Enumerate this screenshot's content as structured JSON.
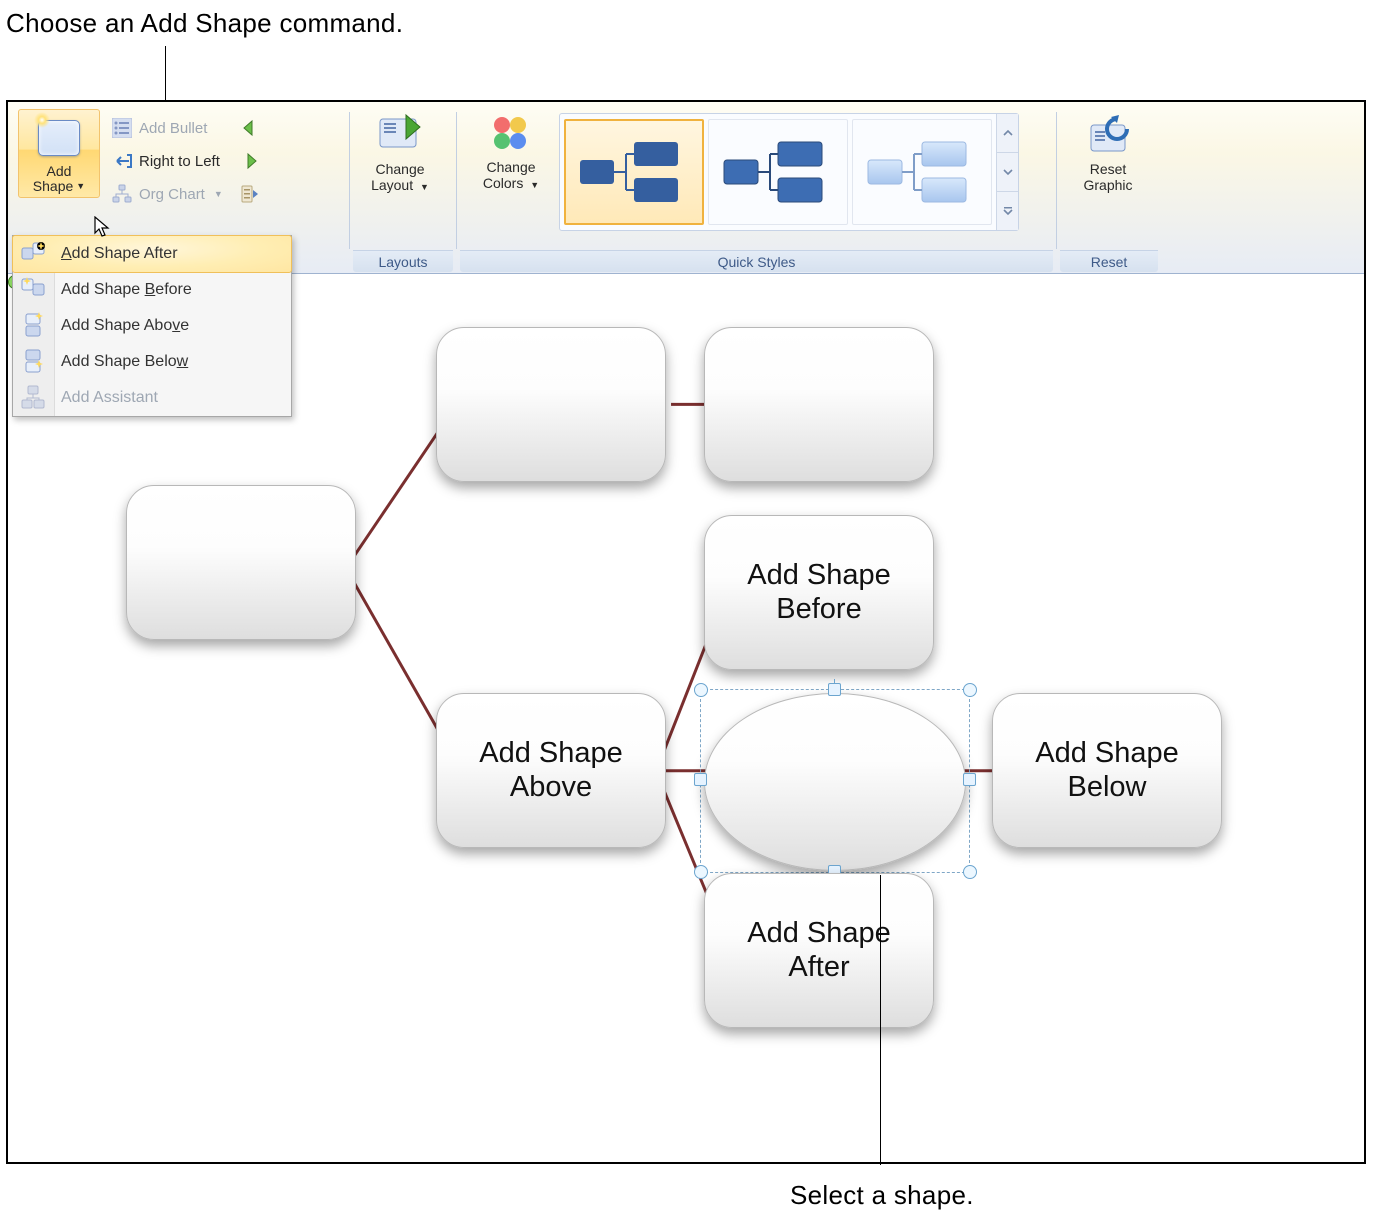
{
  "annotations": {
    "top": "Choose an Add Shape command.",
    "bottom": "Select a shape."
  },
  "ribbon": {
    "groups": {
      "create_graphic": {
        "add_shape": {
          "line1": "Add",
          "line2": "Shape"
        },
        "add_bullet": "Add Bullet",
        "rtl": "Right to Left",
        "org_chart": "Org Chart"
      },
      "layouts": {
        "label": "Layouts",
        "change_layout": "Change Layout"
      },
      "quick_styles": {
        "label": "Quick Styles",
        "change_colors": "Change Colors"
      },
      "reset": {
        "label": "Reset",
        "reset_graphic": "Reset Graphic"
      }
    }
  },
  "dropdown": {
    "items": [
      {
        "text": "Add Shape After",
        "underline": "A",
        "enabled": true,
        "hover": true
      },
      {
        "text": "Add Shape Before",
        "underline": "B",
        "enabled": true,
        "hover": false
      },
      {
        "text": "Add Shape Above",
        "underline": "v",
        "enabled": true,
        "hover": false
      },
      {
        "text": "Add Shape Below",
        "underline": "w",
        "enabled": true,
        "hover": false
      },
      {
        "text": "Add Assistant",
        "underline": "t",
        "enabled": false,
        "hover": false
      }
    ]
  },
  "diagram": {
    "nodes": {
      "above": "Add Shape Above",
      "before": "Add Shape Before",
      "after": "Add Shape After",
      "below": "Add Shape Below"
    }
  }
}
